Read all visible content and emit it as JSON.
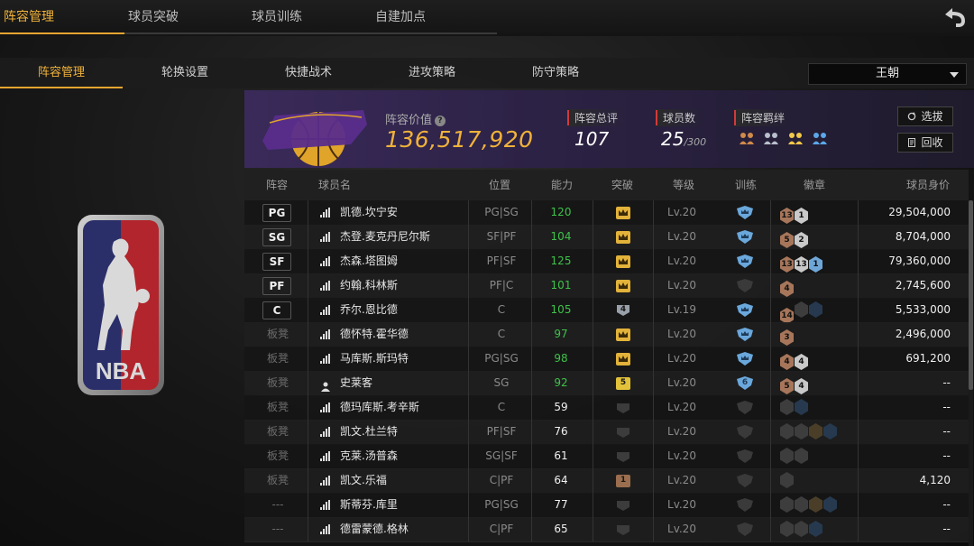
{
  "top_tabs": [
    {
      "label": "阵容管理",
      "active": true
    },
    {
      "label": "球员突破",
      "active": false
    },
    {
      "label": "球员训练",
      "active": false
    },
    {
      "label": "自建加点",
      "active": false
    }
  ],
  "sub_tabs": [
    {
      "label": "阵容管理",
      "active": true
    },
    {
      "label": "轮换设置",
      "active": false
    },
    {
      "label": "快捷战术",
      "active": false
    },
    {
      "label": "进攻策略",
      "active": false
    },
    {
      "label": "防守策略",
      "active": false
    }
  ],
  "team_select": {
    "value": "王朝"
  },
  "team": {
    "value_label": "阵容价值",
    "value": "136,517,920",
    "stats": [
      {
        "label": "阵容总评",
        "value": "107",
        "suffix": ""
      },
      {
        "label": "球员数",
        "value": "25",
        "suffix": "/300"
      },
      {
        "label": "阵容羁绊",
        "value": "",
        "suffix": ""
      }
    ],
    "bond_icons": [
      "bond-orange-icon",
      "bond-silver-icon",
      "bond-gold-icon",
      "bond-blue-icon"
    ]
  },
  "buttons": {
    "select": "选拔",
    "recycle": "回收"
  },
  "table": {
    "headers": [
      "阵容",
      "球员名",
      "位置",
      "能力",
      "突破",
      "等级",
      "训练",
      "徽章",
      "球员身价"
    ],
    "rows": [
      {
        "slot": "PG",
        "boxed": true,
        "icon": "signal",
        "name": "凯德.坎宁安",
        "position": "PG|SG",
        "ability": "120",
        "ability_color": "#3fc14a",
        "break": "crown",
        "break_num": "",
        "level": "Lv.20",
        "train": "blue",
        "badges": [
          [
            "bronze",
            "13"
          ],
          [
            "silver",
            "1"
          ]
        ],
        "value": "29,504,000"
      },
      {
        "slot": "SG",
        "boxed": true,
        "icon": "signal",
        "name": "杰登.麦克丹尼尔斯",
        "position": "SF|PF",
        "ability": "104",
        "ability_color": "#3fc14a",
        "break": "crown",
        "break_num": "",
        "level": "Lv.20",
        "train": "blue",
        "badges": [
          [
            "bronze",
            "5"
          ],
          [
            "silver",
            "2"
          ]
        ],
        "value": "8,704,000"
      },
      {
        "slot": "SF",
        "boxed": true,
        "icon": "signal",
        "name": "杰森.塔图姆",
        "position": "PF|SF",
        "ability": "125",
        "ability_color": "#3fc14a",
        "break": "crown",
        "break_num": "",
        "level": "Lv.20",
        "train": "blue",
        "badges": [
          [
            "bronze",
            "13"
          ],
          [
            "silver",
            "13"
          ],
          [
            "blue",
            "1"
          ]
        ],
        "value": "79,360,000"
      },
      {
        "slot": "PF",
        "boxed": true,
        "icon": "signal",
        "name": "约翰.科林斯",
        "position": "PF|C",
        "ability": "101",
        "ability_color": "#3fc14a",
        "break": "crown",
        "break_num": "",
        "level": "Lv.20",
        "train": "grey",
        "badges": [
          [
            "bronze",
            "4"
          ]
        ],
        "value": "2,745,600"
      },
      {
        "slot": "C",
        "boxed": true,
        "icon": "signal",
        "name": "乔尔.恩比德",
        "position": "C",
        "ability": "105",
        "ability_color": "#3fc14a",
        "break": "num",
        "break_num": "4",
        "level": "Lv.19",
        "train": "blue",
        "badges": [
          [
            "bronze",
            "14"
          ],
          [
            "dark",
            ""
          ],
          [
            "darkblue",
            ""
          ]
        ],
        "value": "5,533,000"
      },
      {
        "slot": "板凳",
        "boxed": false,
        "icon": "signal",
        "name": "德怀特.霍华德",
        "position": "C",
        "ability": "97",
        "ability_color": "#3fc14a",
        "break": "crown",
        "break_num": "",
        "level": "Lv.20",
        "train": "blue",
        "badges": [
          [
            "bronze",
            "3"
          ]
        ],
        "value": "2,496,000"
      },
      {
        "slot": "板凳",
        "boxed": false,
        "icon": "signal",
        "name": "马库斯.斯玛特",
        "position": "PG|SG",
        "ability": "98",
        "ability_color": "#3fc14a",
        "break": "crown",
        "break_num": "",
        "level": "Lv.20",
        "train": "blue",
        "badges": [
          [
            "bronze",
            "4"
          ],
          [
            "silver",
            "4"
          ]
        ],
        "value": "691,200"
      },
      {
        "slot": "板凳",
        "boxed": false,
        "icon": "person",
        "name": "史莱客",
        "position": "SG",
        "ability": "92",
        "ability_color": "#3fc14a",
        "break": "gold",
        "break_num": "5",
        "level": "Lv.20",
        "train": "blue6",
        "badges": [
          [
            "bronze",
            "5"
          ],
          [
            "silver",
            "4"
          ]
        ],
        "value": "--"
      },
      {
        "slot": "板凳",
        "boxed": false,
        "icon": "signal",
        "name": "德玛库斯.考辛斯",
        "position": "C",
        "ability": "59",
        "ability_color": "#f0f0f0",
        "break": "empty",
        "break_num": "",
        "level": "Lv.20",
        "train": "grey",
        "badges": [
          [
            "dark",
            ""
          ],
          [
            "darkblue",
            ""
          ]
        ],
        "value": "--"
      },
      {
        "slot": "板凳",
        "boxed": false,
        "icon": "signal",
        "name": "凯文.杜兰特",
        "position": "PF|SF",
        "ability": "76",
        "ability_color": "#f0f0f0",
        "break": "empty",
        "break_num": "",
        "level": "Lv.20",
        "train": "grey",
        "badges": [
          [
            "dark",
            ""
          ],
          [
            "dark",
            ""
          ],
          [
            "darkgold",
            ""
          ],
          [
            "darkblue",
            ""
          ]
        ],
        "value": "--"
      },
      {
        "slot": "板凳",
        "boxed": false,
        "icon": "signal",
        "name": "克莱.汤普森",
        "position": "SG|SF",
        "ability": "61",
        "ability_color": "#f0f0f0",
        "break": "empty",
        "break_num": "",
        "level": "Lv.20",
        "train": "grey",
        "badges": [
          [
            "dark",
            ""
          ],
          [
            "dark",
            ""
          ]
        ],
        "value": "--"
      },
      {
        "slot": "板凳",
        "boxed": false,
        "icon": "signal",
        "name": "凯文.乐福",
        "position": "C|PF",
        "ability": "64",
        "ability_color": "#f0f0f0",
        "break": "bronze",
        "break_num": "1",
        "level": "Lv.20",
        "train": "grey",
        "badges": [
          [
            "dark",
            ""
          ]
        ],
        "value": "4,120"
      },
      {
        "slot": "---",
        "boxed": false,
        "icon": "signal",
        "name": "斯蒂芬.库里",
        "position": "PG|SG",
        "ability": "77",
        "ability_color": "#f0f0f0",
        "break": "empty",
        "break_num": "",
        "level": "Lv.20",
        "train": "grey",
        "badges": [
          [
            "dark",
            ""
          ],
          [
            "dark",
            ""
          ],
          [
            "darkgold",
            ""
          ],
          [
            "darkblue",
            ""
          ]
        ],
        "value": "--"
      },
      {
        "slot": "---",
        "boxed": false,
        "icon": "signal",
        "name": "德雷蒙德.格林",
        "position": "C|PF",
        "ability": "65",
        "ability_color": "#f0f0f0",
        "break": "empty",
        "break_num": "",
        "level": "Lv.20",
        "train": "grey",
        "badges": [
          [
            "dark",
            ""
          ],
          [
            "dark",
            ""
          ],
          [
            "darkblue",
            ""
          ]
        ],
        "value": "--"
      }
    ]
  }
}
